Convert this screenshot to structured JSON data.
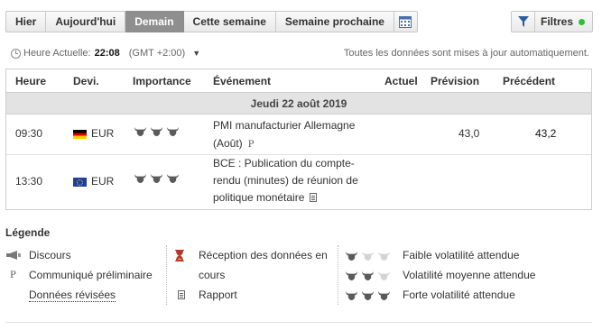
{
  "tabs": [
    {
      "label": "Hier",
      "active": false
    },
    {
      "label": "Aujourd'hui",
      "active": false
    },
    {
      "label": "Demain",
      "active": true
    },
    {
      "label": "Cette semaine",
      "active": false
    },
    {
      "label": "Semaine prochaine",
      "active": false
    }
  ],
  "filters": {
    "label": "Filtres",
    "status_color": "#2fbf3a"
  },
  "timebar": {
    "label": "Heure Actuelle:",
    "time": "22:08",
    "timezone": "(GMT +2:00)",
    "autoupdate": "Toutes les données sont mises à jour automatiquement."
  },
  "table": {
    "headers": {
      "time": "Heure",
      "currency": "Devi.",
      "importance": "Importance",
      "event": "Événement",
      "actual": "Actuel",
      "forecast": "Prévision",
      "previous": "Précédent"
    },
    "date_row": "Jeudi 22 août 2019",
    "rows": [
      {
        "time": "09:30",
        "flag": "germany-flag",
        "currency": "EUR",
        "importance": 3,
        "event_lines": [
          "PMI manufacturier Allemagne",
          "(Août)"
        ],
        "event_badge": "P",
        "actual": "",
        "forecast": "43,0",
        "previous": "43,2"
      },
      {
        "time": "13:30",
        "flag": "eu-flag",
        "currency": "EUR",
        "importance": 3,
        "event_lines": [
          "BCE : Publication du compte-",
          "rendu (minutes) de réunion de",
          "politique monétaire"
        ],
        "event_badge": "doc-icon",
        "actual": "",
        "forecast": "",
        "previous": ""
      }
    ]
  },
  "legend": {
    "title": "Légende",
    "col1": [
      {
        "icon": "megaphone-icon",
        "label": "Discours"
      },
      {
        "icon": "P",
        "label": "Communiqué préliminaire"
      },
      {
        "icon": "",
        "label": "Données révisées"
      }
    ],
    "col2": [
      {
        "icon": "hourglass-icon",
        "label_lines": [
          "Réception des données en",
          "cours"
        ]
      },
      {
        "icon": "doc-icon",
        "label": "Rapport"
      }
    ],
    "col3": [
      {
        "level": 1,
        "label": "Faible volatilité attendue"
      },
      {
        "level": 2,
        "label": "Volatilité moyenne attendue"
      },
      {
        "level": 3,
        "label": "Forte volatilité attendue"
      }
    ]
  },
  "colors": {
    "bull_active": "#5a5a5a",
    "bull_inactive": "#d4d4d4",
    "active_tab": "#8f8f8f"
  }
}
